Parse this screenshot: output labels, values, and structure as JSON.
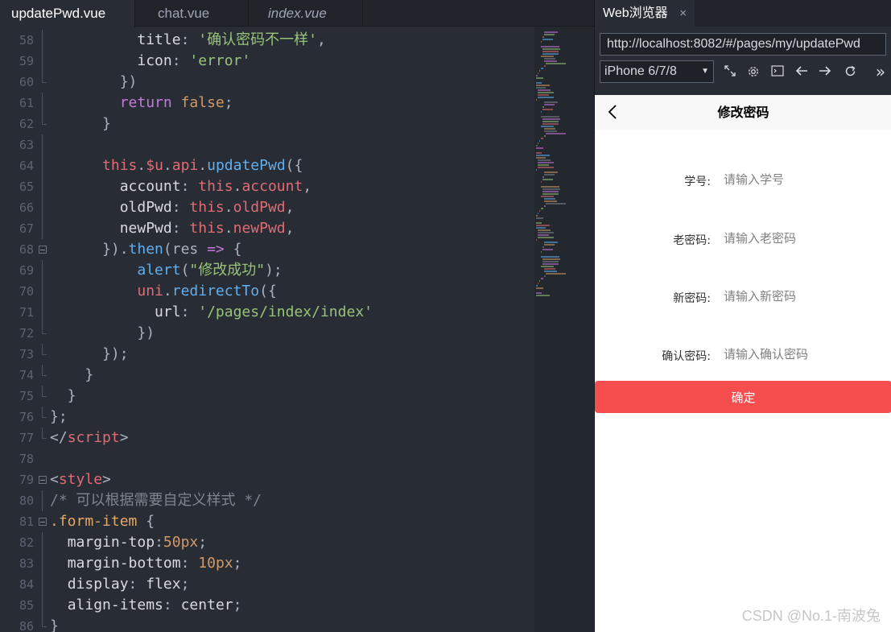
{
  "editor": {
    "tabs": [
      {
        "label": "updatePwd.vue",
        "active": true
      },
      {
        "label": "chat.vue",
        "active": false
      },
      {
        "label": "index.vue",
        "active": false,
        "italic": true
      }
    ],
    "lines": [
      {
        "n": "58",
        "fold": "vline",
        "tokens": [
          [
            "p",
            "          "
          ],
          [
            "prop",
            "title"
          ],
          [
            "p",
            ": "
          ],
          [
            "str",
            "'确认密码不一样'"
          ],
          [
            "p",
            ","
          ]
        ]
      },
      {
        "n": "59",
        "fold": "vline",
        "tokens": [
          [
            "p",
            "          "
          ],
          [
            "prop",
            "icon"
          ],
          [
            "p",
            ": "
          ],
          [
            "str",
            "'error'"
          ]
        ]
      },
      {
        "n": "60",
        "fold": "tick",
        "tokens": [
          [
            "p",
            "        })"
          ]
        ]
      },
      {
        "n": "61",
        "fold": "vline",
        "tokens": [
          [
            "p",
            "        "
          ],
          [
            "kw",
            "return"
          ],
          [
            "p",
            " "
          ],
          [
            "num",
            "false"
          ],
          [
            "p",
            ";"
          ]
        ]
      },
      {
        "n": "62",
        "fold": "tick",
        "tokens": [
          [
            "p",
            "      }"
          ]
        ]
      },
      {
        "n": "63",
        "fold": "vline",
        "tokens": []
      },
      {
        "n": "64",
        "fold": "vline",
        "tokens": [
          [
            "p",
            "      "
          ],
          [
            "this",
            "this"
          ],
          [
            "p",
            "."
          ],
          [
            "this",
            "$u"
          ],
          [
            "p",
            "."
          ],
          [
            "this",
            "api"
          ],
          [
            "p",
            "."
          ],
          [
            "fn",
            "updatePwd"
          ],
          [
            "p",
            "({"
          ]
        ]
      },
      {
        "n": "65",
        "fold": "vline",
        "tokens": [
          [
            "p",
            "        "
          ],
          [
            "prop",
            "account"
          ],
          [
            "p",
            ": "
          ],
          [
            "this",
            "this"
          ],
          [
            "p",
            "."
          ],
          [
            "this",
            "account"
          ],
          [
            "p",
            ","
          ]
        ]
      },
      {
        "n": "66",
        "fold": "vline",
        "tokens": [
          [
            "p",
            "        "
          ],
          [
            "prop",
            "oldPwd"
          ],
          [
            "p",
            ": "
          ],
          [
            "this",
            "this"
          ],
          [
            "p",
            "."
          ],
          [
            "this",
            "oldPwd"
          ],
          [
            "p",
            ","
          ]
        ]
      },
      {
        "n": "67",
        "fold": "vline",
        "tokens": [
          [
            "p",
            "        "
          ],
          [
            "prop",
            "newPwd"
          ],
          [
            "p",
            ": "
          ],
          [
            "this",
            "this"
          ],
          [
            "p",
            "."
          ],
          [
            "this",
            "newPwd"
          ],
          [
            "p",
            ","
          ]
        ]
      },
      {
        "n": "68",
        "fold": "box",
        "tokens": [
          [
            "p",
            "      })."
          ],
          [
            "fn",
            "then"
          ],
          [
            "p",
            "(res "
          ],
          [
            "kw",
            "=>"
          ],
          [
            "p",
            " {"
          ]
        ]
      },
      {
        "n": "69",
        "fold": "vline",
        "tokens": [
          [
            "p",
            "          "
          ],
          [
            "fn",
            "alert"
          ],
          [
            "p",
            "("
          ],
          [
            "str",
            "\"修改成功\""
          ],
          [
            "p",
            ");"
          ]
        ]
      },
      {
        "n": "70",
        "fold": "vline",
        "tokens": [
          [
            "p",
            "          "
          ],
          [
            "this",
            "uni"
          ],
          [
            "p",
            "."
          ],
          [
            "fn",
            "redirectTo"
          ],
          [
            "p",
            "({"
          ]
        ]
      },
      {
        "n": "71",
        "fold": "vline",
        "tokens": [
          [
            "p",
            "            "
          ],
          [
            "prop",
            "url"
          ],
          [
            "p",
            ": "
          ],
          [
            "str",
            "'/pages/index/index'"
          ]
        ]
      },
      {
        "n": "72",
        "fold": "tick",
        "tokens": [
          [
            "p",
            "          })"
          ]
        ]
      },
      {
        "n": "73",
        "fold": "tick",
        "tokens": [
          [
            "p",
            "      });"
          ]
        ]
      },
      {
        "n": "74",
        "fold": "tick",
        "tokens": [
          [
            "p",
            "    }"
          ]
        ]
      },
      {
        "n": "75",
        "fold": "tick",
        "tokens": [
          [
            "p",
            "  }"
          ]
        ]
      },
      {
        "n": "76",
        "fold": "tick",
        "tokens": [
          [
            "p",
            "};"
          ]
        ]
      },
      {
        "n": "77",
        "fold": "tick",
        "tokens": [
          [
            "p",
            "</"
          ],
          [
            "tag",
            "script"
          ],
          [
            "p",
            ">"
          ]
        ]
      },
      {
        "n": "78",
        "fold": "none",
        "tokens": []
      },
      {
        "n": "79",
        "fold": "box",
        "tokens": [
          [
            "p",
            "<"
          ],
          [
            "tag",
            "style"
          ],
          [
            "p",
            ">"
          ]
        ]
      },
      {
        "n": "80",
        "fold": "vline",
        "tokens": [
          [
            "cmt",
            "/* 可以根据需要自定义样式 */"
          ]
        ]
      },
      {
        "n": "81",
        "fold": "box",
        "tokens": [
          [
            "cls",
            ".form-item"
          ],
          [
            "p",
            " {"
          ]
        ]
      },
      {
        "n": "82",
        "fold": "vline",
        "tokens": [
          [
            "p",
            "  "
          ],
          [
            "prop",
            "margin-top"
          ],
          [
            "p",
            ":"
          ],
          [
            "num",
            "50px"
          ],
          [
            "p",
            ";"
          ]
        ]
      },
      {
        "n": "83",
        "fold": "vline",
        "tokens": [
          [
            "p",
            "  "
          ],
          [
            "prop",
            "margin-bottom"
          ],
          [
            "p",
            ": "
          ],
          [
            "num",
            "10px"
          ],
          [
            "p",
            ";"
          ]
        ]
      },
      {
        "n": "84",
        "fold": "vline",
        "tokens": [
          [
            "p",
            "  "
          ],
          [
            "prop",
            "display"
          ],
          [
            "p",
            ": "
          ],
          [
            "prop",
            "flex"
          ],
          [
            "p",
            ";"
          ]
        ]
      },
      {
        "n": "85",
        "fold": "vline",
        "tokens": [
          [
            "p",
            "  "
          ],
          [
            "prop",
            "align-items"
          ],
          [
            "p",
            ": "
          ],
          [
            "prop",
            "center"
          ],
          [
            "p",
            ";"
          ]
        ]
      },
      {
        "n": "86",
        "fold": "tick",
        "tokens": [
          [
            "p",
            "}"
          ]
        ]
      }
    ]
  },
  "browser": {
    "tab_label": "Web浏览器",
    "tab_close": "×",
    "url": "http://localhost:8082/#/pages/my/updatePwd",
    "device": "iPhone 6/7/8",
    "more": "»"
  },
  "phone": {
    "nav_title": "修改密码",
    "fields": [
      {
        "label": "学号:",
        "placeholder": "请输入学号"
      },
      {
        "label": "老密码:",
        "placeholder": "请输入老密码"
      },
      {
        "label": "新密码:",
        "placeholder": "请输入新密码"
      },
      {
        "label": "确认密码:",
        "placeholder": "请输入确认密码"
      }
    ],
    "confirm_label": "确定"
  },
  "watermark": "CSDN @No.1-南波兔",
  "colors": {
    "editor_bg": "#282c34",
    "accent_button": "#f64e4e",
    "string": "#98c379",
    "keyword": "#c678dd",
    "this": "#e06c75",
    "function": "#61afef"
  }
}
